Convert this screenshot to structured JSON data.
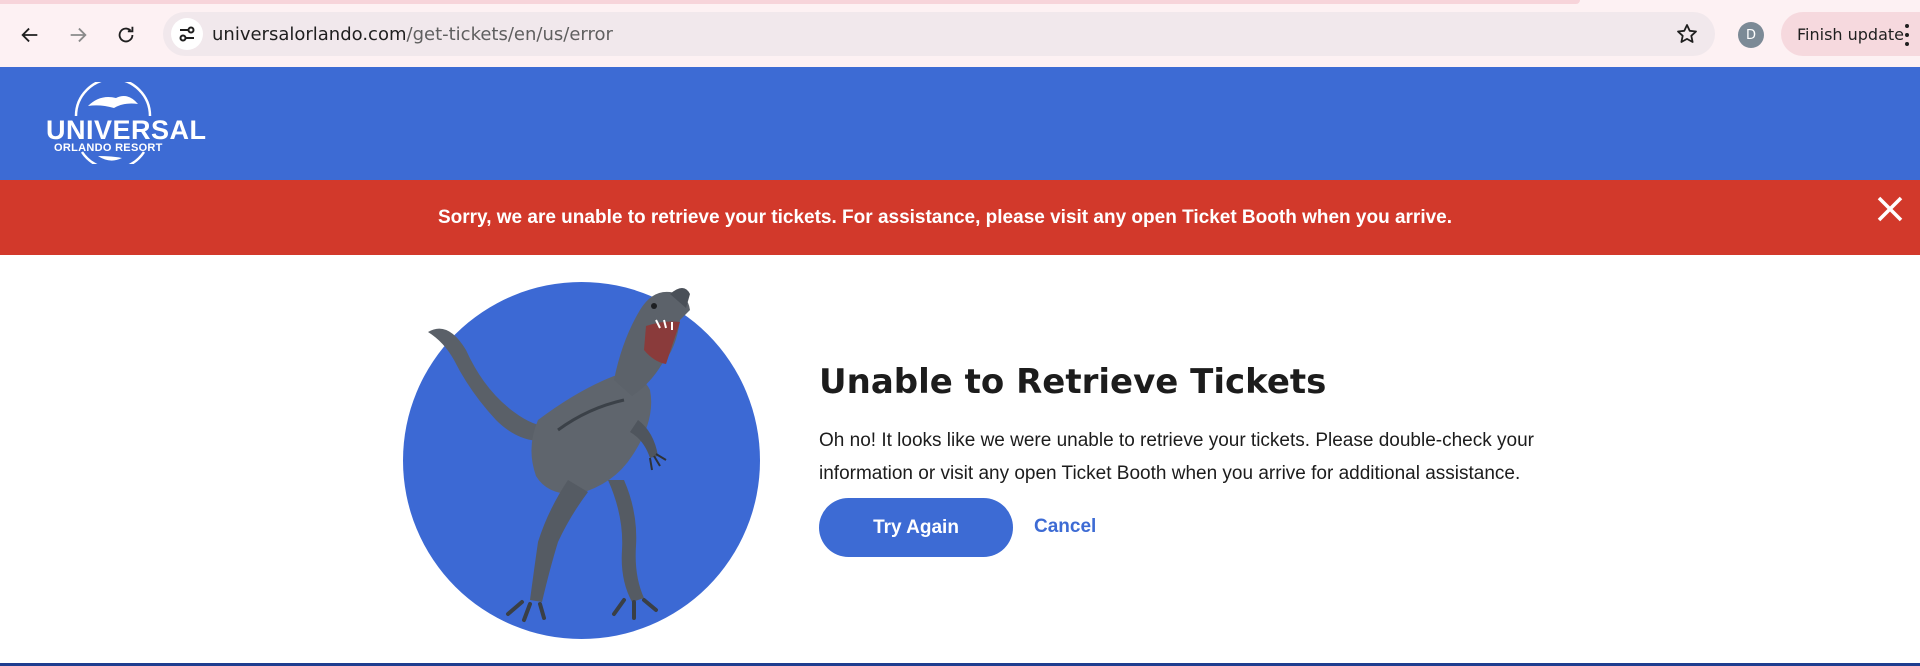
{
  "browser": {
    "url_domain": "universalorlando.com",
    "url_path": "/get-tickets/en/us/error",
    "profile_initial": "D",
    "update_label": "Finish update",
    "icons": [
      "back-icon",
      "forward-icon",
      "reload-icon",
      "site-info-icon",
      "bookmark-star-icon",
      "more-menu-icon"
    ]
  },
  "header": {
    "logo_top": "UNIVERSAL",
    "logo_bottom": "ORLANDO RESORT",
    "color": "#3d6bd4"
  },
  "banner": {
    "message": "Sorry, we are unable to retrieve your tickets. For assistance, please visit any open Ticket Booth when you arrive.",
    "color": "#d2392b",
    "close_icon": "close-icon"
  },
  "error": {
    "title": "Unable to Retrieve Tickets",
    "body": "Oh no! It looks like we were unable to retrieve your tickets. Please double-check your information or visit any open Ticket Booth when you arrive for additional assistance.",
    "primary_button": "Try Again",
    "secondary_link": "Cancel",
    "accent": "#3d6bd4"
  }
}
